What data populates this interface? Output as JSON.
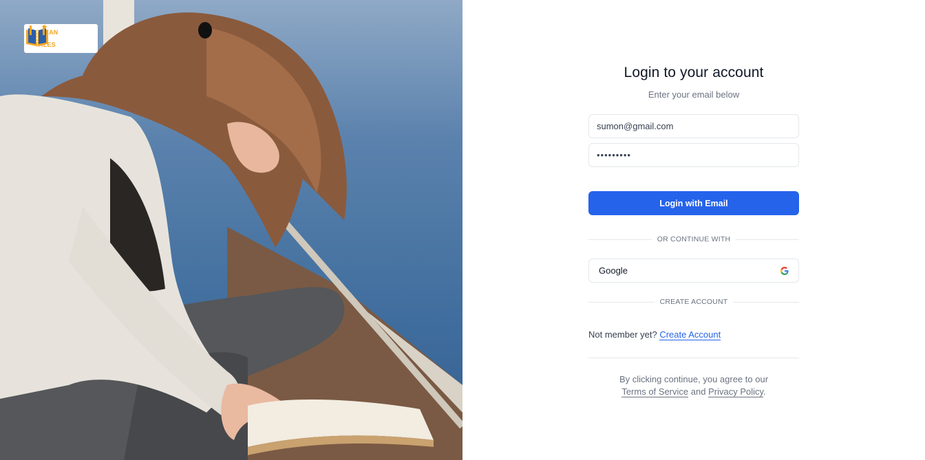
{
  "logo": {
    "line1": "OCEAN",
    "line2": "OF",
    "line3": "TALES",
    "icon": "open-book-icon",
    "color": "#f5a623"
  },
  "hero_image": {
    "alt": "woman-reading-book-on-dock-photo"
  },
  "form": {
    "title": "Login to your account",
    "subtitle": "Enter your email below",
    "email_value": "sumon@gmail.com",
    "password_value": "•••••••••",
    "login_button": "Login with Email",
    "or_divider": "OR CONTINUE WITH",
    "google_button": "Google",
    "google_icon": "google-g-icon",
    "create_divider": "CREATE ACCOUNT",
    "not_member_text": "Not member yet?",
    "create_account_link": "Create Account",
    "terms_prefix": "By clicking continue, you agree to our",
    "terms_link": "Terms of Service",
    "terms_and": "and",
    "privacy_link": "Privacy Policy",
    "terms_suffix": "."
  },
  "colors": {
    "primary": "#2563eb",
    "border": "#e5e7eb",
    "muted_text": "#6b7280"
  }
}
